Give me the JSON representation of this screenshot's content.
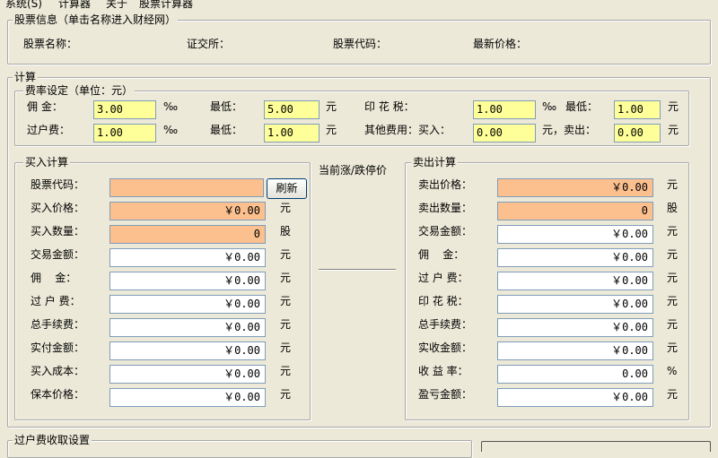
{
  "menu": [
    "系统(S)",
    "计算器",
    "关于",
    "股票计算器"
  ],
  "stock_info": {
    "title": "股票信息（单击名称进入财经网）",
    "name_label": "股票名称：",
    "exchange_label": "证交所：",
    "code_label": "股票代码：",
    "price_label": "最新价格："
  },
  "calc": {
    "title": "计算",
    "rate": {
      "title": "费率设定（单位：元）",
      "commission_label": "佣  金：",
      "commission_value": "3.00",
      "permille_1": "‰",
      "min_label_1": "最低：",
      "min_commission": "5.00",
      "unit_yuan_1": "元",
      "stamp_label": "印 花 税：",
      "stamp_value": "1.00",
      "permille_stamp": "‰",
      "min_label_stamp": "最低：",
      "min_stamp": "1.00",
      "unit_yuan_stamp": "元",
      "transfer_label": "过户费：",
      "transfer_value": "1.00",
      "permille_2": "‰",
      "min_label_2": "最低：",
      "min_transfer": "1.00",
      "unit_yuan_2": "元",
      "other_label": "其他费用：买入：",
      "other_buy": "0.00",
      "sell_sep": "元，卖出：",
      "other_sell": "0.00",
      "unit_yuan_3": "元"
    },
    "limit_title": "当前涨/跌停价",
    "buy": {
      "title": "买入计算",
      "refresh_button": "刷新",
      "rows": [
        {
          "label": "股票代码：",
          "value": "",
          "unit": ""
        },
        {
          "label": "买入价格：",
          "value": "￥0.00",
          "unit": "元"
        },
        {
          "label": "买入数量：",
          "value": "0",
          "unit": "股"
        },
        {
          "label": "交易金额：",
          "value": "￥0.00",
          "unit": "元"
        },
        {
          "label": "佣    金：",
          "value": "￥0.00",
          "unit": "元"
        },
        {
          "label": "过 户 费：",
          "value": "￥0.00",
          "unit": "元"
        },
        {
          "label": "总手续费：",
          "value": "￥0.00",
          "unit": "元"
        },
        {
          "label": "实付金额：",
          "value": "￥0.00",
          "unit": "元"
        },
        {
          "label": "买入成本：",
          "value": "￥0.00",
          "unit": "元"
        },
        {
          "label": "保本价格：",
          "value": "￥0.00",
          "unit": "元"
        }
      ]
    },
    "sell": {
      "title": "卖出计算",
      "rows": [
        {
          "label": "卖出价格：",
          "value": "￥0.00",
          "unit": "元"
        },
        {
          "label": "卖出数量：",
          "value": "0",
          "unit": "股"
        },
        {
          "label": "交易金额：",
          "value": "￥0.00",
          "unit": "元"
        },
        {
          "label": "佣    金：",
          "value": "￥0.00",
          "unit": "元"
        },
        {
          "label": "过 户 费：",
          "value": "￥0.00",
          "unit": "元"
        },
        {
          "label": "印 花 税：",
          "value": "￥0.00",
          "unit": "元"
        },
        {
          "label": "总手续费：",
          "value": "￥0.00",
          "unit": "元"
        },
        {
          "label": "实收金额：",
          "value": "￥0.00",
          "unit": "元"
        },
        {
          "label": "收 益 率：",
          "value": "0.00",
          "unit": "%"
        },
        {
          "label": "盈亏金额：",
          "value": "￥0.00",
          "unit": "元"
        }
      ]
    }
  },
  "transfer_setting": {
    "title": "过户费收取设置"
  },
  "colors": {
    "window_bg": "#ece9d8",
    "yellow_input": "#ffff99",
    "orange_input": "#fcc08f",
    "input_border": "#7f9db9"
  }
}
